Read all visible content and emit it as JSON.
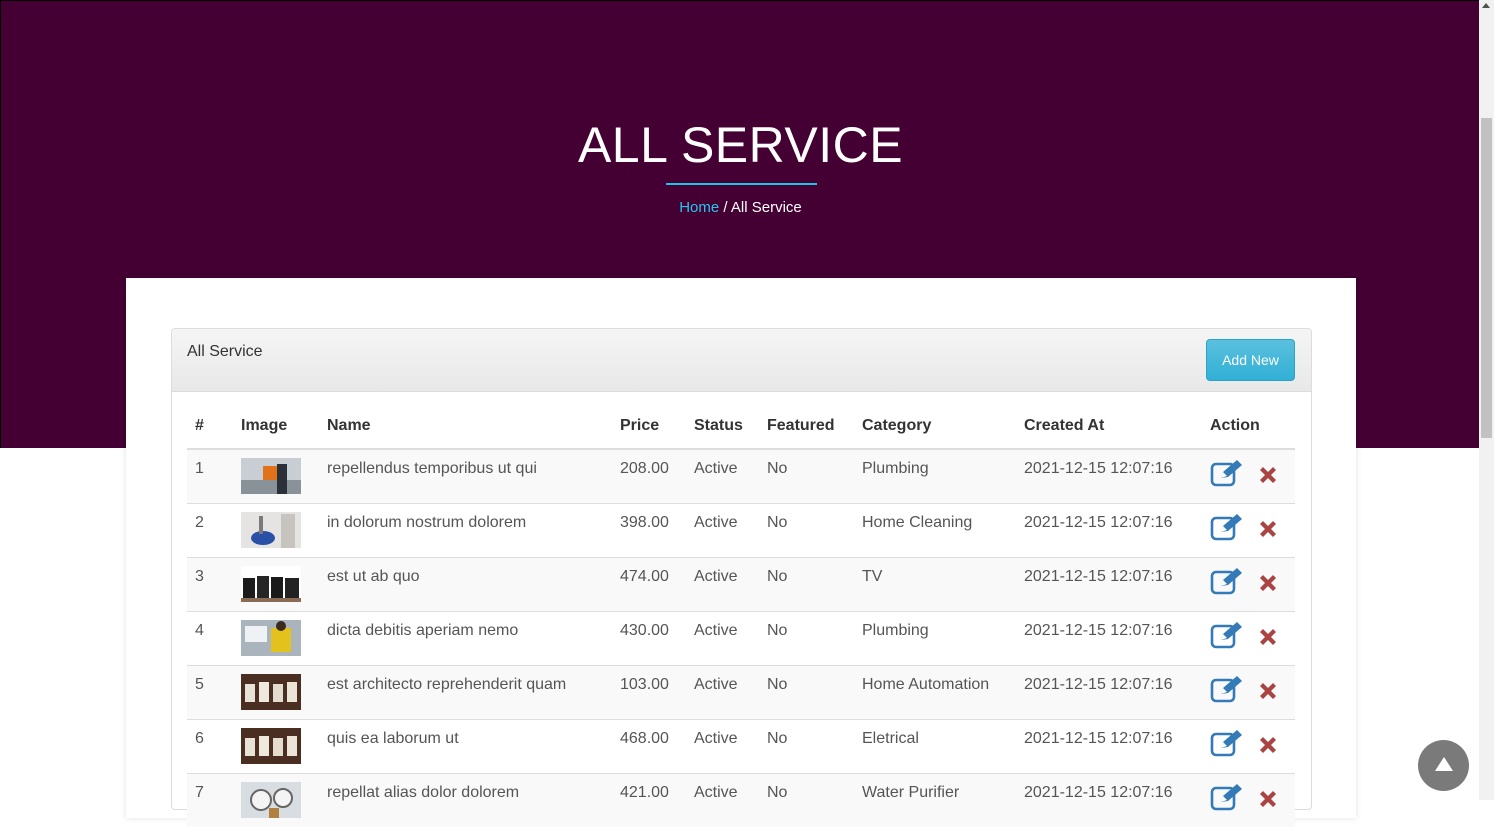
{
  "hero": {
    "title": "ALL SERVICE",
    "breadcrumb_home": "Home",
    "breadcrumb_sep": "/",
    "breadcrumb_current": "All Service"
  },
  "panel": {
    "title": "All Service",
    "add_button": "Add New"
  },
  "table": {
    "headers": [
      "#",
      "Image",
      "Name",
      "Price",
      "Status",
      "Featured",
      "Category",
      "Created At",
      "Action"
    ],
    "rows": [
      {
        "num": "1",
        "image": "service-photo-cleaning-worker",
        "name": "repellendus temporibus ut qui",
        "price": "208.00",
        "status": "Active",
        "featured": "No",
        "category": "Plumbing",
        "created": "2021-12-15 12:07:16"
      },
      {
        "num": "2",
        "image": "service-photo-floor-polisher",
        "name": "in dolorum nostrum dolorem",
        "price": "398.00",
        "status": "Active",
        "featured": "No",
        "category": "Home Cleaning",
        "created": "2021-12-15 12:07:16"
      },
      {
        "num": "3",
        "image": "service-photo-tv-units",
        "name": "est ut ab quo",
        "price": "474.00",
        "status": "Active",
        "featured": "No",
        "category": "TV",
        "created": "2021-12-15 12:07:16"
      },
      {
        "num": "4",
        "image": "service-photo-worker-yellow",
        "name": "dicta debitis aperiam nemo",
        "price": "430.00",
        "status": "Active",
        "featured": "No",
        "category": "Plumbing",
        "created": "2021-12-15 12:07:16"
      },
      {
        "num": "5",
        "image": "service-photo-chairs",
        "name": "est architecto reprehenderit quam",
        "price": "103.00",
        "status": "Active",
        "featured": "No",
        "category": "Home Automation",
        "created": "2021-12-15 12:07:16"
      },
      {
        "num": "6",
        "image": "service-photo-chairs",
        "name": "quis ea laborum ut",
        "price": "468.00",
        "status": "Active",
        "featured": "No",
        "category": "Eletrical",
        "created": "2021-12-15 12:07:16"
      },
      {
        "num": "7",
        "image": "service-photo-gauge",
        "name": "repellat alias dolor dolorem",
        "price": "421.00",
        "status": "Active",
        "featured": "No",
        "category": "Water Purifier",
        "created": "2021-12-15 12:07:16"
      }
    ]
  },
  "icons": {
    "edit": "edit-icon",
    "delete": "delete-icon",
    "scroll_top": "arrow-up-icon"
  },
  "colors": {
    "hero_bg": "#440033",
    "accent": "#1ec3e6",
    "edit": "#337ab7",
    "delete": "#a94442",
    "button": "#5bc0de"
  }
}
